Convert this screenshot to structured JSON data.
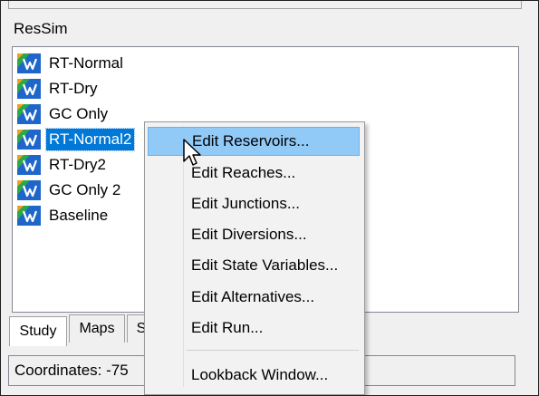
{
  "panel": {
    "title": "ResSim"
  },
  "tree": {
    "items": [
      {
        "label": "RT-Normal",
        "selected": false
      },
      {
        "label": "RT-Dry",
        "selected": false
      },
      {
        "label": "GC Only",
        "selected": false
      },
      {
        "label": "RT-Normal2",
        "selected": true
      },
      {
        "label": "RT-Dry2",
        "selected": false
      },
      {
        "label": "GC Only 2",
        "selected": false
      },
      {
        "label": "Baseline",
        "selected": false
      }
    ],
    "icon": "alternative-icon"
  },
  "context_menu": {
    "items": [
      {
        "label": "Edit Reservoirs..."
      },
      {
        "label": "Edit Reaches..."
      },
      {
        "label": "Edit Junctions..."
      },
      {
        "label": "Edit Diversions..."
      },
      {
        "label": "Edit State Variables..."
      },
      {
        "label": "Edit Alternatives..."
      },
      {
        "label": "Edit Run..."
      },
      {
        "label": "Lookback Window..."
      }
    ]
  },
  "tabs": [
    {
      "label": "Study",
      "active": true
    },
    {
      "label": "Maps",
      "active": false
    },
    {
      "label": "S",
      "active": false
    }
  ],
  "status": {
    "text": "Coordinates: -75"
  },
  "colors": {
    "selection": "#0078d7",
    "menu_hover": "#91c9f7"
  }
}
